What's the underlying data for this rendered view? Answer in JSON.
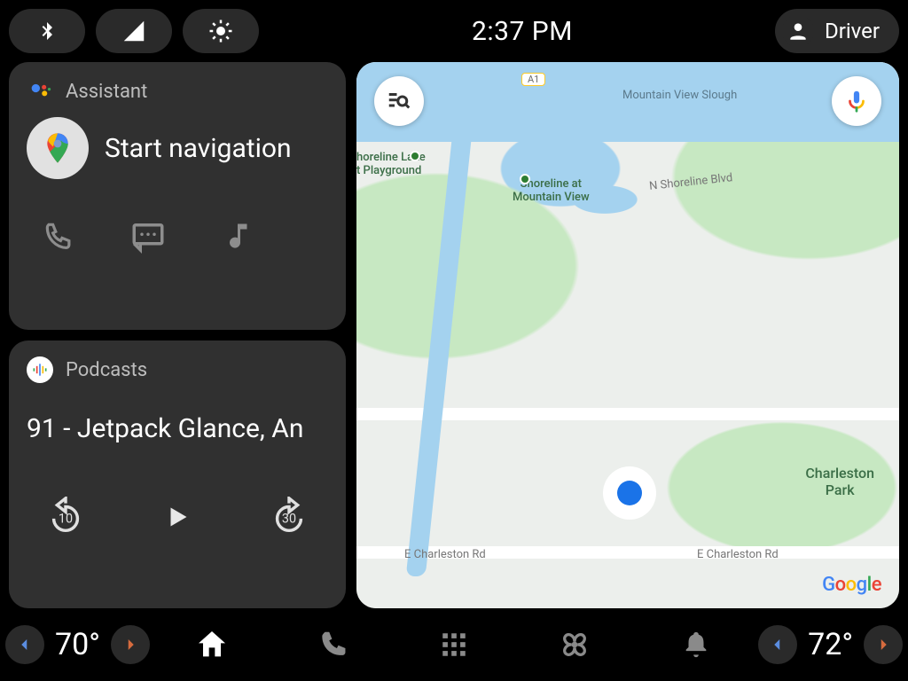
{
  "status": {
    "time": "2:37 PM",
    "profile_label": "Driver"
  },
  "assistant_card": {
    "header": "Assistant",
    "title": "Start navigation"
  },
  "podcasts_card": {
    "header": "Podcasts",
    "title": "91 - Jetpack Glance, An",
    "rewind_seconds": "10",
    "forward_seconds": "30"
  },
  "map": {
    "poi_shoreline": "Shoreline at\nMountain View",
    "poi_lake": "horeline Lake\nt Playground",
    "poi_charleston": "Charleston\nPark",
    "poi_slough": "Mountain View Slough",
    "road_nshoreline": "N Shoreline Blvd",
    "road_echarleston_l": "E Charleston Rd",
    "road_echarleston_r": "E Charleston Rd",
    "route_a1": "A1"
  },
  "bottom": {
    "temp_left": "70°",
    "temp_right": "72°"
  }
}
